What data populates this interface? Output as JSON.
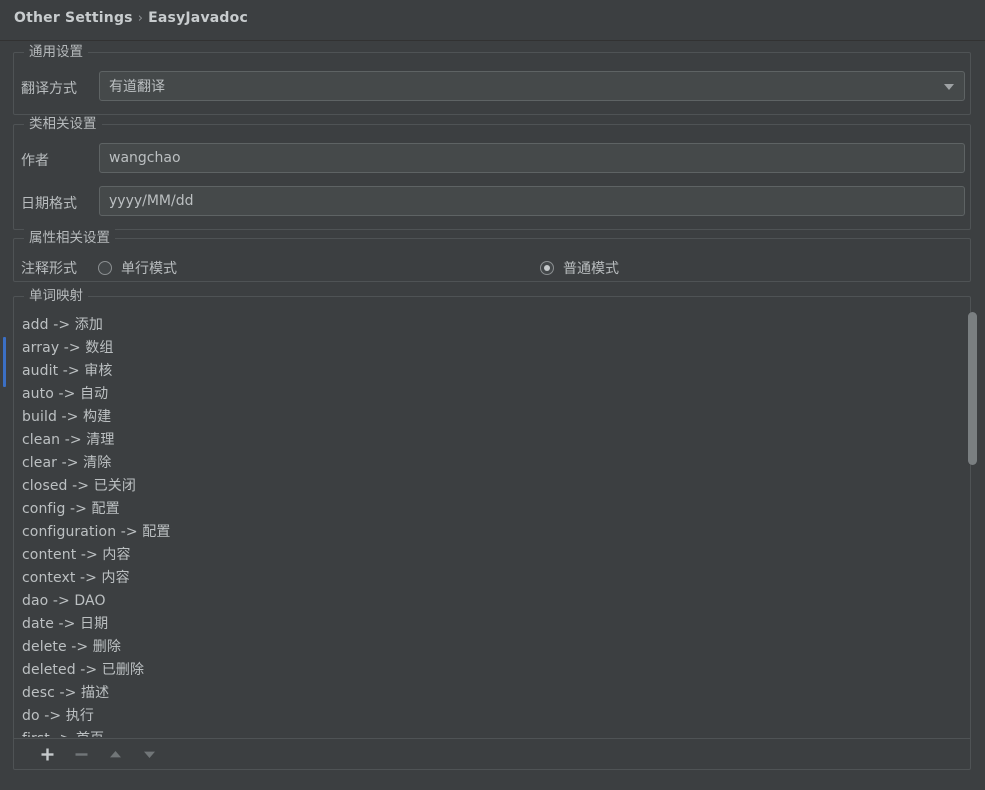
{
  "header": {
    "breadcrumb_parent": "Other Settings",
    "breadcrumb_separator": "›",
    "breadcrumb_current": "EasyJavadoc"
  },
  "colors": {
    "window_background": "#3c3f41",
    "panel_border": "#4f5355",
    "field_background": "#45494a",
    "field_border": "#5e6364",
    "text_primary": "#bbbfc1",
    "text_label": "#b8bcbe",
    "accent_selection": "#3b6fc4",
    "scrollbar_thumb": "#7a7f81"
  },
  "general_settings": {
    "group_title": "通用设置",
    "translator_label": "翻译方式",
    "translator_value": "有道翻译",
    "translator_icon": "chevron-down-icon"
  },
  "class_settings": {
    "group_title": "类相关设置",
    "author_label": "作者",
    "author_value": "wangchao",
    "date_format_label": "日期格式",
    "date_format_value": "yyyy/MM/dd"
  },
  "field_settings": {
    "group_title": "属性相关设置",
    "comment_mode_label": "注释形式",
    "options": [
      {
        "label": "单行模式",
        "selected": false
      },
      {
        "label": "普通模式",
        "selected": true
      }
    ]
  },
  "word_mapping": {
    "group_title": "单词映射",
    "items": [
      "add -> 添加",
      "array -> 数组",
      "audit -> 审核",
      "auto -> 自动",
      "build -> 构建",
      "clean -> 清理",
      "clear -> 清除",
      "closed -> 已关闭",
      "config -> 配置",
      "configuration -> 配置",
      "content -> 内容",
      "context -> 内容",
      "dao -> DAO",
      "date -> 日期",
      "delete -> 删除",
      "deleted -> 已删除",
      "desc -> 描述",
      "do -> 执行",
      "first -> 首页"
    ],
    "toolbar": [
      {
        "name": "add-row-button",
        "icon": "plus-icon",
        "enabled": true
      },
      {
        "name": "remove-row-button",
        "icon": "minus-icon",
        "enabled": false
      },
      {
        "name": "move-up-button",
        "icon": "arrow-up-icon",
        "enabled": false
      },
      {
        "name": "move-down-button",
        "icon": "arrow-down-icon",
        "enabled": false
      }
    ]
  }
}
